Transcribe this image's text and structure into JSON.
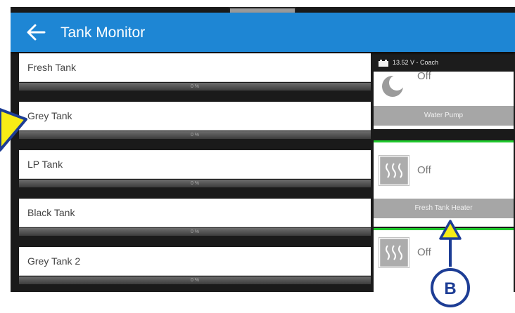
{
  "header": {
    "title": "Tank Monitor"
  },
  "tanks": [
    {
      "name": "Fresh Tank",
      "level": "0 %"
    },
    {
      "name": "Grey Tank",
      "level": "0 %"
    },
    {
      "name": "LP Tank",
      "level": "0 %"
    },
    {
      "name": "Black Tank",
      "level": "0 %"
    },
    {
      "name": "Grey Tank 2",
      "level": "0 %"
    }
  ],
  "status": {
    "text": "13.52 V - Coach"
  },
  "devices": [
    {
      "state": "Off",
      "label": "Water Pump"
    },
    {
      "state": "Off",
      "label": "Fresh Tank Heater"
    },
    {
      "state": "Off",
      "label": ""
    }
  ],
  "annotation": {
    "callout": "B"
  },
  "colors": {
    "appbar": "#1e86d4",
    "active": "#20c92c",
    "callout_fill": "#f7ec16",
    "callout_stroke": "#1d3d95"
  },
  "icons": [
    "back-arrow-icon",
    "battery-icon",
    "water-pump-icon",
    "heater-icon"
  ]
}
